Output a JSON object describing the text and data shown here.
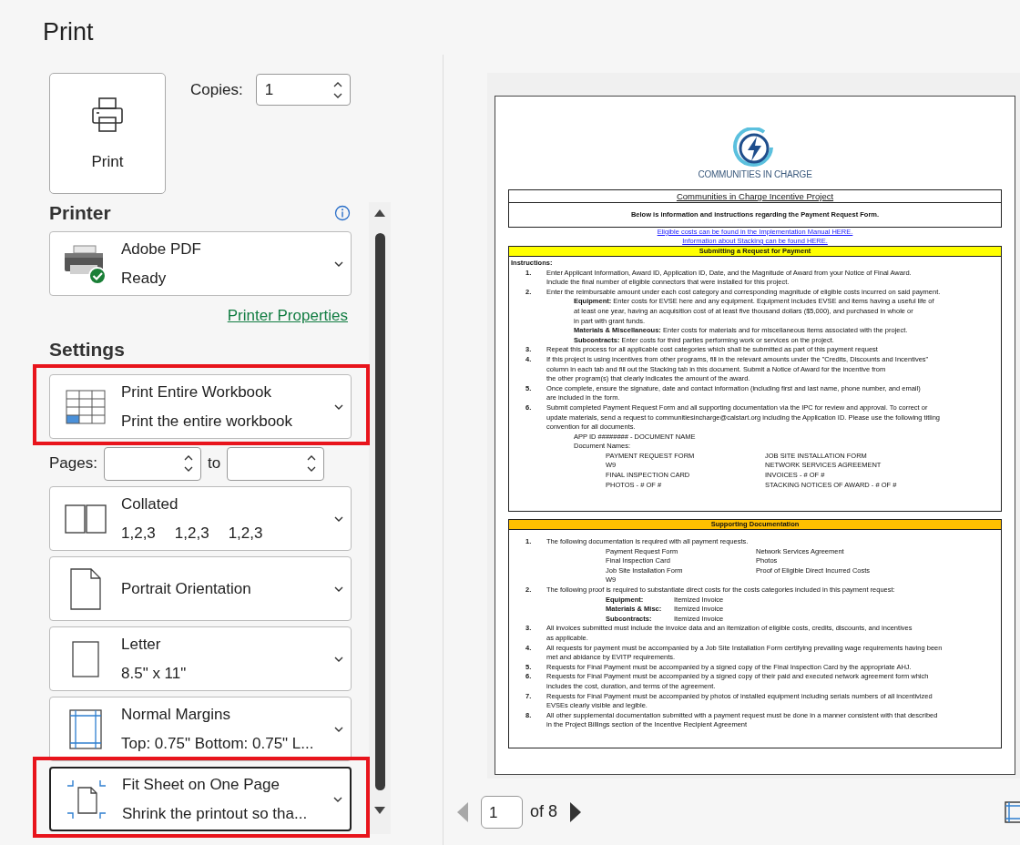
{
  "title": "Print",
  "print_button": {
    "label": "Print"
  },
  "copies": {
    "label": "Copies:",
    "value": "1"
  },
  "printer": {
    "heading": "Printer",
    "name": "Adobe PDF",
    "status": "Ready",
    "properties_link": "Printer Properties"
  },
  "settings": {
    "heading": "Settings",
    "items": [
      {
        "kind": "workbook",
        "title": "Print Entire Workbook",
        "subtitle": [
          "Print the entire workbook"
        ],
        "highlighted": true,
        "focused": false
      },
      {
        "kind": "pages",
        "label": "Pages:",
        "to": "to"
      },
      {
        "kind": "collated",
        "title": "Collated",
        "subtitle": [
          "1,2,3",
          "1,2,3",
          "1,2,3"
        ],
        "highlighted": false,
        "focused": false
      },
      {
        "kind": "orientation",
        "title": "Portrait Orientation",
        "highlighted": false,
        "focused": false
      },
      {
        "kind": "paper",
        "title": "Letter",
        "subtitle": [
          "8.5\" x 11\""
        ],
        "highlighted": false,
        "focused": false
      },
      {
        "kind": "margins",
        "title": "Normal Margins",
        "subtitle": [
          "Top: 0.75\" Bottom: 0.75\" L..."
        ],
        "highlighted": false,
        "focused": false
      },
      {
        "kind": "scaling",
        "title": "Fit Sheet on One Page",
        "subtitle": [
          "Shrink the printout so tha..."
        ],
        "highlighted": true,
        "focused": true
      }
    ]
  },
  "document": {
    "logo": "COMMUNITIES IN CHARGE",
    "title": "Communities in Charge Incentive Project",
    "intro": "Below is information and instructions regarding the Payment Request Form.",
    "links": [
      "Eligible costs can be found in the Implementation Manual HERE.",
      "Information about Stacking can be found HERE."
    ],
    "sections": [
      {
        "heading": "Submitting a Request for Payment",
        "color": "#ffff00",
        "label": "Instructions:",
        "items": [
          {
            "num": "1.",
            "lines": [
              "Enter Applicant Information, Award ID, Application ID, Date, and the Magnitude of Award from your Notice of Final Award.",
              "Include the final number of eligible connectors that were installed for this project."
            ]
          },
          {
            "num": "2.",
            "lines": [
              "Enter the reimbursable amount under each cost category and corresponding magnitude of eligible costs incurred on said payment."
            ],
            "children": [
              {
                "kind": "para",
                "lines": [
                  "**Equipment:** Enter costs for EVSE here and any equipment. Equipment includes EVSE and items having a useful life of",
                  "at least one year, having an acquisition cost of at least five thousand dollars ($5,000), and purchased in whole or",
                  "in part with grant funds."
                ]
              },
              {
                "kind": "para",
                "lines": [
                  "**Materials & Miscellaneous:** Enter costs for materials and for miscellaneous items associated with the project."
                ]
              },
              {
                "kind": "para",
                "lines": [
                  "**Subcontracts:** Enter costs for third parties performing work or services on the project."
                ]
              }
            ]
          },
          {
            "num": "3.",
            "lines": [
              "Repeat this process for all applicable cost categories which shall be submitted as part of this payment request"
            ]
          },
          {
            "num": "4.",
            "lines": [
              "If this project is using incentives from other programs, fill in the relevant amounts under the \"Credits, Discounts and Incentives\"",
              "column in each tab and fill out the Stacking tab in this document. Submit a Notice of Award for the incentive from",
              "the other program(s) that clearly indicates the amount of the award."
            ]
          },
          {
            "num": "5.",
            "lines": [
              "Once complete, ensure the signature, date and contact information (including first and last name, phone number, and email)",
              "are included in the form."
            ]
          },
          {
            "num": "6.",
            "lines": [
              "Submit completed Payment Request Form and all supporting documentation via the IPC for review and approval. To correct or",
              "update materials, send a request to communitiesincharge@calstart.org including the Application ID. Please use the following titling",
              "convention for all documents."
            ],
            "children": [
              {
                "kind": "para",
                "lines": [
                  "APP ID ######## - DOCUMENT NAME",
                  "Document Names:"
                ]
              },
              {
                "kind": "grid",
                "rows": [
                  [
                    "PAYMENT REQUEST FORM",
                    "JOB SITE INSTALLATION FORM"
                  ],
                  [
                    "W9",
                    "NETWORK SERVICES AGREEMENT"
                  ],
                  [
                    "FINAL INSPECTION CARD",
                    "INVOICES - # OF #"
                  ],
                  [
                    "PHOTOS - # OF #",
                    "STACKING NOTICES OF AWARD - # OF #"
                  ]
                ]
              }
            ]
          }
        ]
      },
      {
        "heading": "Supporting Documentation",
        "color": "#ffc000",
        "items": [
          {
            "num": "1.",
            "lines": [
              "The following documentation is required with all payment requests."
            ],
            "children": [
              {
                "kind": "list",
                "rows": [
                  [
                    "Payment Request Form",
                    "Network Services Agreement"
                  ],
                  [
                    "Final Inspection Card",
                    "Photos"
                  ],
                  [
                    "Job Site Installation Form",
                    "Proof of Eligible Direct Incurred Costs"
                  ],
                  [
                    "W9"
                  ]
                ]
              }
            ]
          },
          {
            "num": "2.",
            "lines": [
              "The following proof is required to substantiate direct costs for the costs categories included in this payment request:"
            ],
            "children": [
              {
                "kind": "labels",
                "rows": [
                  [
                    "Equipment:",
                    "Itemized Invoice"
                  ],
                  [
                    "Materials & Misc:",
                    "Itemized Invoice"
                  ],
                  [
                    "Subcontracts:",
                    "Itemized Invoice"
                  ]
                ]
              }
            ]
          },
          {
            "num": "3.",
            "lines": [
              "All invoices submitted must include the invoice data and an itemization of eligible costs, credits, discounts, and incentives",
              "as applicable."
            ]
          },
          {
            "num": "4.",
            "lines": [
              "All requests for payment must be accompanied by a Job Site Installation Form certifying prevailing wage requirements having been",
              "met and abidance by EVITP requirements."
            ]
          },
          {
            "num": "5.",
            "lines": [
              "Requests for Final Payment must be accompanied by a signed copy of the Final Inspection Card by the appropriate AHJ."
            ]
          },
          {
            "num": "6.",
            "lines": [
              "Requests for Final Payment must be accompanied by a signed copy of their paid and executed network agreement form which",
              "includes the cost, duration, and terms of the agreement."
            ]
          },
          {
            "num": "7.",
            "lines": [
              "Requests for Final Payment must be accompanied by photos of installed equipment including serials numbers of all incentivized",
              "EVSEs clearly visible and legible."
            ]
          },
          {
            "num": "8.",
            "lines": [
              "All other supplemental documentation submitted with a payment request must be done in a manner consistent with that described",
              "in the Project Billings section of the Incentive Recipient Agreement"
            ]
          }
        ]
      }
    ]
  },
  "page_nav": {
    "page": "1",
    "of": "of 8",
    "prev_disabled": true,
    "next_disabled": false
  }
}
